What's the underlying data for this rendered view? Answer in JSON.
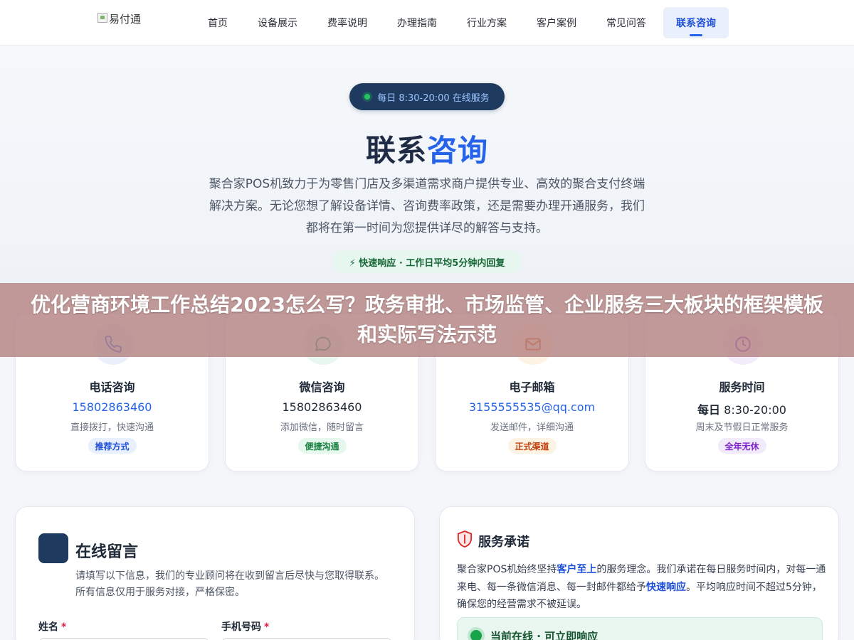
{
  "nav": {
    "logo_alt": "易付通",
    "items": [
      "首页",
      "设备展示",
      "费率说明",
      "办理指南",
      "行业方案",
      "客户案例",
      "常见问答",
      "联系咨询"
    ]
  },
  "hero": {
    "pill": "每日 8:30-20:00 在线服务",
    "title_main": "联系",
    "title_accent": "咨询",
    "description": "聚合家POS机致力于为零售门店及多渠道需求商户提供专业、高效的聚合支付终端解决方案。无论您想了解设备详情、咨询费率政策，还是需要办理开通服务，我们都将在第一时间为您提供详尽的解答与支持。",
    "quick_tag": "⚡ 快速响应 · 工作日平均5分钟内回复"
  },
  "overlay": {
    "text": "优化营商环境工作总结2023怎么写？政务审批、市场监管、企业服务三大板块的框架模板和实际写法示范"
  },
  "cards": [
    {
      "icon": "phone-icon",
      "title": "电话咨询",
      "value": "15802863460",
      "sub": "直接拨打，快速沟通",
      "badge": "推荐方式",
      "badge_bg": "#e8f0fd",
      "badge_fg": "#1d4ed8",
      "icon_bg": "#eaf1fd",
      "icon_fg": "#2563eb"
    },
    {
      "icon": "wechat-icon",
      "title": "微信咨询",
      "value": "15802863460",
      "sub": "添加微信，随时留言",
      "badge": "便捷沟通",
      "badge_bg": "#e6f7ee",
      "badge_fg": "#15803d",
      "icon_bg": "#e8f7ef",
      "icon_fg": "#16a34a"
    },
    {
      "icon": "mail-icon",
      "title": "电子邮箱",
      "value": "3155555535@qq.com",
      "sub": "发送邮件，详细沟通",
      "badge": "正式渠道",
      "badge_bg": "#fdf3e4",
      "badge_fg": "#c2410c",
      "icon_bg": "#fdf2e3",
      "icon_fg": "#ea580c"
    },
    {
      "icon": "clock-icon",
      "title": "服务时间",
      "value_bold": "每日",
      "value": "8:30-20:00",
      "sub": "周末及节假日正常服务",
      "badge": "全年无休",
      "badge_bg": "#f1eafb",
      "badge_fg": "#7e22ce",
      "icon_bg": "#f3ecfb",
      "icon_fg": "#9333ea"
    }
  ],
  "message": {
    "title": "在线留言",
    "desc": "请填写以下信息，我们的专业顾问将在收到留言后尽快与您取得联系。所有信息仅用于服务对接，严格保密。",
    "name_label": "姓名",
    "phone_label": "手机号码",
    "required_mark": "*"
  },
  "service": {
    "title": "服务承诺",
    "text_1": "聚合家POS机始终坚持",
    "emph_1": "客户至上",
    "text_2": "的服务理念。我们承诺在每日服务时间内，对每一通来电、每一条微信消息、每一封邮件都给予",
    "emph_2": "快速响应",
    "text_3": "。平均响应时间不超过5分钟，确保您的经营需求不被延误。",
    "online": "当前在线 · 可立即响应"
  }
}
